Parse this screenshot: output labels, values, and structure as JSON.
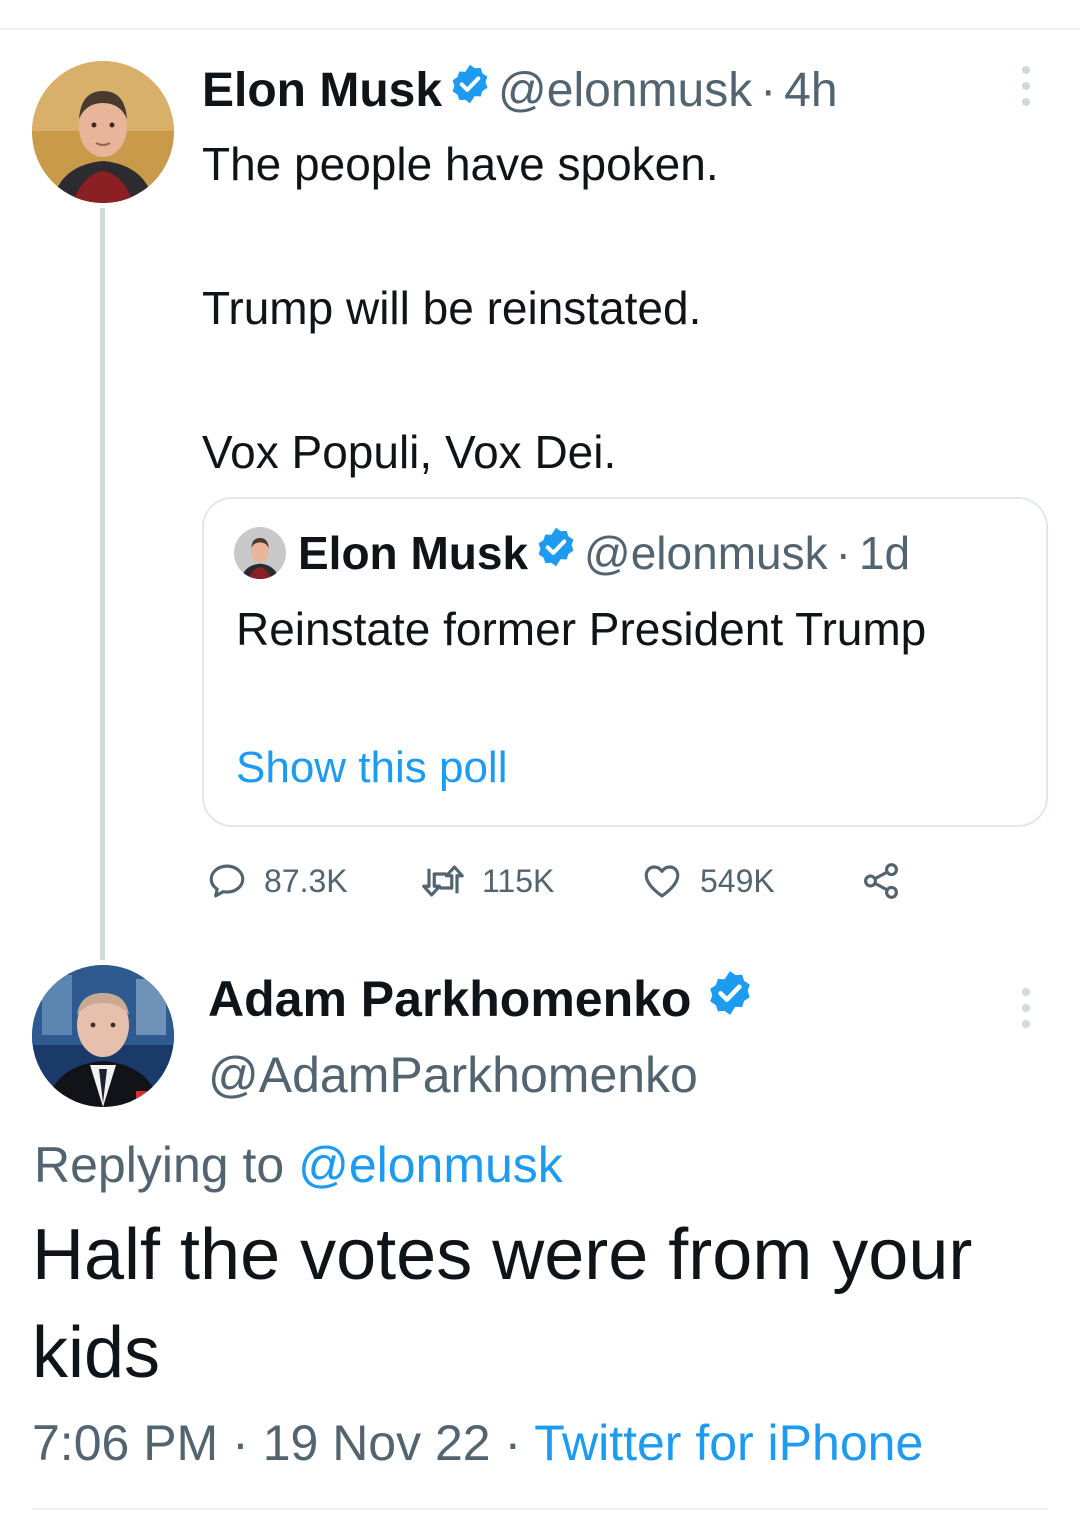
{
  "colors": {
    "accent": "#1d9bf0",
    "text": "#0f1419",
    "muted": "#536471",
    "border": "#cfd9de"
  },
  "main_tweet": {
    "avatar_icon": "user-avatar-icon",
    "name": "Elon Musk",
    "handle": "@elonmusk",
    "separator": "·",
    "time": "4h",
    "lines": [
      "The people have spoken.",
      "Trump will be reinstated.",
      "Vox Populi, Vox Dei."
    ]
  },
  "quoted_tweet": {
    "name": "Elon Musk",
    "handle": "@elonmusk",
    "separator": "·",
    "time": "1d",
    "text": "Reinstate former President Trump",
    "link": "Show this poll"
  },
  "actions": {
    "replies": "87.3K",
    "retweets": "115K",
    "likes": "549K"
  },
  "reply_tweet": {
    "name": "Adam Parkhomenko",
    "handle": "@AdamParkhomenko",
    "replying_prefix": "Replying to",
    "replying_to": "@elonmusk",
    "text": "Half the votes were from your kids",
    "time": "7:06 PM",
    "date": "19 Nov 22",
    "separator": "·",
    "source": "Twitter for iPhone"
  }
}
